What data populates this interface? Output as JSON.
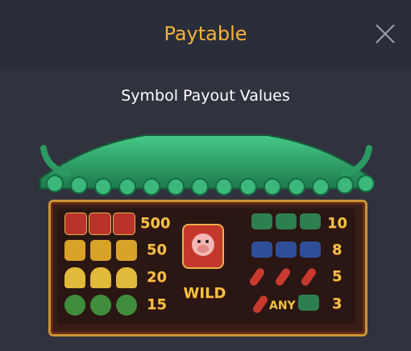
{
  "header": {
    "title": "Paytable"
  },
  "section": {
    "subtitle": "Symbol Payout Values"
  },
  "payouts": {
    "left_column": [
      {
        "symbol": "pig-piggy-bank",
        "value": "500"
      },
      {
        "symbol": "gold-pig-statue",
        "value": "50"
      },
      {
        "symbol": "gold-ingot",
        "value": "20"
      },
      {
        "symbol": "green-cabbage",
        "value": "15"
      }
    ],
    "right_column": [
      {
        "symbol": "green-firecracker",
        "value": "10"
      },
      {
        "symbol": "blue-firecracker",
        "value": "8"
      },
      {
        "symbol": "red-firecracker",
        "value": "5"
      },
      {
        "symbol": "any-firecracker",
        "value": "3"
      }
    ],
    "wild_label": "WILD",
    "any_label": "ANY"
  },
  "colors": {
    "title": "#f5b43a",
    "background": "#2b2f3c",
    "value_text": "#f5c046",
    "roof_green": "#2a9a62",
    "board_border": "#c99434"
  }
}
